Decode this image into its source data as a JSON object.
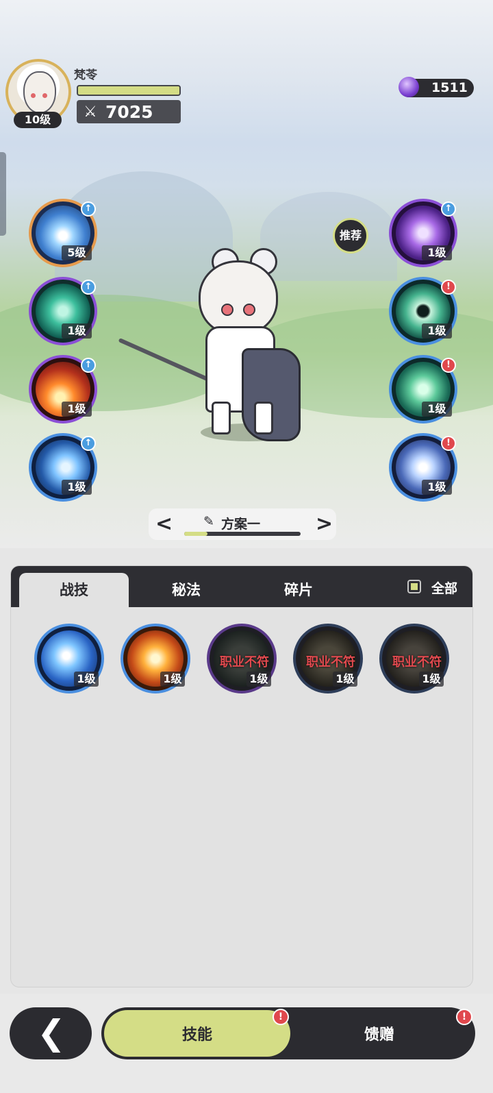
{
  "character": {
    "name": "梵苓",
    "level": "10级",
    "power": "7025",
    "power_icon": "crossed-swords-icon"
  },
  "currency": {
    "value": "1511",
    "icon": "purple-gem-icon"
  },
  "recommend_label": "推荐",
  "left_skills": [
    {
      "level": "5级",
      "theme": "ice-shatter",
      "indicator": "upgrade"
    },
    {
      "level": "1级",
      "theme": "green-vortex",
      "indicator": "upgrade"
    },
    {
      "level": "1级",
      "theme": "fireball",
      "indicator": "upgrade"
    },
    {
      "level": "1级",
      "theme": "ice-crystal",
      "indicator": "upgrade"
    }
  ],
  "right_skills": [
    {
      "level": "1级",
      "theme": "purple-swirl",
      "indicator": "upgrade"
    },
    {
      "level": "1级",
      "theme": "green-ward",
      "indicator": "alert"
    },
    {
      "level": "1级",
      "theme": "green-shield",
      "indicator": "alert"
    },
    {
      "level": "1级",
      "theme": "blue-star",
      "indicator": "alert"
    }
  ],
  "plan": {
    "label": "方案一",
    "prev": "<",
    "next": ">",
    "progress": 0.2
  },
  "tabs": [
    "战技",
    "秘法",
    "碎片"
  ],
  "active_tab": "战技",
  "filter_all_label": "全部",
  "skill_list": [
    {
      "level": "1级",
      "theme": "blue-flame",
      "mismatch": ""
    },
    {
      "level": "1级",
      "theme": "orange-burst",
      "mismatch": ""
    },
    {
      "level": "1级",
      "theme": "dark",
      "mismatch": "职业不符"
    },
    {
      "level": "1级",
      "theme": "dark",
      "mismatch": "职业不符"
    },
    {
      "level": "1级",
      "theme": "dark",
      "mismatch": "职业不符"
    }
  ],
  "bottom": {
    "back_icon": "back-arrow-icon",
    "skills_label": "技能",
    "gift_label": "馈赠",
    "alert_glyph": "!"
  },
  "colors": {
    "accent": "#d4dd86",
    "dark": "#2b2b30",
    "alert": "#e0484d",
    "upgrade": "#4a9de0"
  }
}
